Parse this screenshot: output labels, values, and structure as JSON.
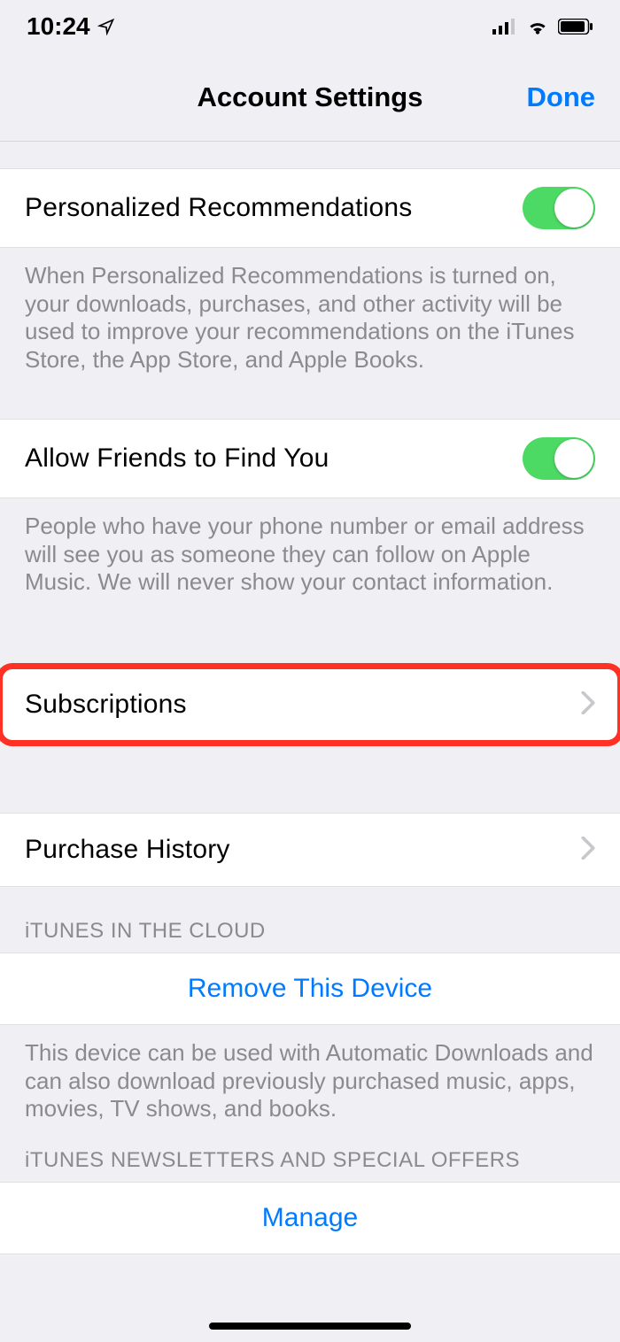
{
  "statusbar": {
    "time": "10:24"
  },
  "nav": {
    "title": "Account Settings",
    "done": "Done"
  },
  "rows": {
    "personalized": {
      "label": "Personalized Recommendations",
      "footer": "When Personalized Recommendations is turned on, your downloads, purchases, and other activity will be used to improve your recommendations on the iTunes Store, the App Store, and Apple Books.",
      "on": true
    },
    "allowFriends": {
      "label": "Allow Friends to Find You",
      "footer": "People who have your phone number or email address will see you as someone they can follow on Apple Music. We will never show your contact information.",
      "on": true
    },
    "subscriptions": {
      "label": "Subscriptions"
    },
    "purchaseHistory": {
      "label": "Purchase History"
    }
  },
  "sections": {
    "cloud": {
      "header": "iTUNES IN THE CLOUD",
      "removeDevice": "Remove This Device",
      "footer": "This device can be used with Automatic Downloads and can also download previously purchased music, apps, movies, TV shows, and books."
    },
    "newsletters": {
      "header": "iTUNES NEWSLETTERS AND SPECIAL OFFERS",
      "manage": "Manage"
    }
  }
}
